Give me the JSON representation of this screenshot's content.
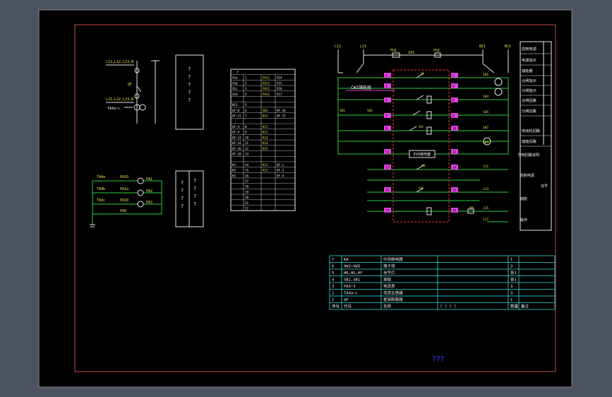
{
  "colors": {
    "app_bg": "#4b5361",
    "sheet_bg": "#000000",
    "sheet_border": "#8a8a8a",
    "frame_border": "#c0504d",
    "wire_white": "#e8e8e8",
    "wire_green": "#2ecc40",
    "wire_magenta": "#e040e0",
    "wire_red": "#ff3030",
    "text_yellow": "#f5e642",
    "text_white": "#f0f0f0",
    "table_cyan": "#38e0e0",
    "stamp_blue": "#3a3aff"
  },
  "one_line": {
    "top_label": "L11,L12,L13,N",
    "mid_label": "L21,L22,L23,N",
    "breaker_label": "QF",
    "ct_label": "TA4a~c"
  },
  "terminal_box_1": {
    "lines": [
      "?",
      "?",
      "?",
      "?",
      "?"
    ]
  },
  "meter_circuit": {
    "rows": [
      {
        "ct": "TA4a",
        "ammeter": "PA1",
        "label": "PA10"
      },
      {
        "ct": "TA4b",
        "ammeter": "PA2",
        "label": "PA1a"
      },
      {
        "ct": "TA4c",
        "ammeter": "PA3",
        "label": "PA10"
      }
    ],
    "device_label": "PA0"
  },
  "terminal_box_2": {
    "col_a": [
      "?",
      "?",
      "?",
      "?"
    ],
    "col_b": [
      "?",
      "?",
      "?",
      "?"
    ]
  },
  "terminal_table": {
    "header": "?",
    "rows": [
      [
        "X1a",
        "1",
        "PA11",
        "X14"
      ],
      [
        "X1b",
        "2",
        "PA11",
        "X15"
      ],
      [
        "X1c",
        "3",
        "PA11",
        "X16"
      ],
      [
        "X1d",
        "4",
        "PA11",
        "X17"
      ],
      [
        "",
        "",
        "",
        ""
      ],
      [
        "N11",
        "5",
        "",
        ""
      ],
      [
        "QF:0",
        "6",
        "SB1",
        "QF:34"
      ],
      [
        "QF:11",
        "7",
        "N11",
        "QF:37"
      ],
      [
        "",
        "",
        "",
        ""
      ],
      [
        "QF:4",
        "8",
        "K11",
        ""
      ],
      [
        "QF:4",
        "9",
        "K12",
        ""
      ],
      [
        "QF:13",
        "10",
        "K13",
        ""
      ],
      [
        "QF:14",
        "11",
        "K14",
        ""
      ],
      [
        "QF:16",
        "12",
        "K15",
        ""
      ],
      [
        "QF:18",
        "13",
        "",
        ""
      ],
      [
        "",
        "",
        "",
        ""
      ],
      [
        "K1",
        "14",
        "K11",
        "QF:1"
      ],
      [
        "K2",
        "15",
        "K12",
        "QF:3"
      ],
      [
        "K3",
        "16",
        "",
        "QF:4"
      ],
      [
        "",
        "17",
        "",
        ""
      ],
      [
        "",
        "18",
        "",
        ""
      ],
      [
        "",
        "19",
        "",
        ""
      ],
      [
        "",
        "20",
        "",
        ""
      ],
      [
        "",
        "21",
        "",
        ""
      ],
      [
        "",
        "22",
        "",
        ""
      ]
    ]
  },
  "control_circuit": {
    "top_labels": [
      "L12",
      "L21",
      "FU1",
      "101",
      "FU2",
      "N21",
      "N11"
    ],
    "left_label": "CWI储能器",
    "node_labels": [
      "1",
      "2",
      "3",
      "4",
      "5",
      "6",
      "7",
      "8",
      "9",
      "10",
      "11",
      "12",
      "13",
      "14",
      "15",
      "16",
      "17",
      "18",
      "19",
      "20",
      "21",
      "22",
      "23",
      "24"
    ],
    "relay_label": "中间继电器",
    "side_labels": [
      "QF",
      "SB1",
      "SB2",
      "KA",
      "HR",
      "HG",
      "KM"
    ],
    "right_numbers": [
      "101",
      "103",
      "105",
      "107",
      "109",
      "111",
      "113",
      "115",
      "117"
    ]
  },
  "function_column": {
    "items": [
      "控制电源",
      "电源指示",
      "储能器",
      "合闸指示",
      "分闸指示",
      "合闸回路",
      "分闸回路",
      "电动机回路",
      "储能回路",
      "控制回路",
      "故障信号",
      "联锁",
      "远方/就地",
      "操作"
    ],
    "header": "控制回路说明",
    "sub1": "控制电源",
    "sub2": "信号",
    "sub3": "储能",
    "sub4": "操作"
  },
  "parts_table": {
    "rows": [
      {
        "no": "7",
        "code": "KA",
        "name": "中间继电器",
        "spec": "",
        "qty": "1",
        "note": ""
      },
      {
        "no": "6",
        "code": "XW1~XW3",
        "name": "端子排",
        "spec": "",
        "qty": "3",
        "note": ""
      },
      {
        "no": "5",
        "code": "HR,HG,HY",
        "name": "信号灯",
        "spec": "",
        "qty": "各1",
        "note": ""
      },
      {
        "no": "4",
        "code": "SB2,SB1",
        "name": "按钮",
        "spec": "",
        "qty": "各1",
        "note": ""
      },
      {
        "no": "3",
        "code": "PA1~3",
        "name": "电流表",
        "spec": "",
        "qty": "3",
        "note": ""
      },
      {
        "no": "2",
        "code": "TA4a~c",
        "name": "电流互感器",
        "spec": "",
        "qty": "3",
        "note": ""
      },
      {
        "no": "1",
        "code": "QF",
        "name": "框架断路器",
        "spec": "",
        "qty": "1",
        "note": ""
      }
    ],
    "header": {
      "no": "序号",
      "code": "代号",
      "name": "名称",
      "spec": "? ? ? ?",
      "qty": "数量",
      "note": "备注"
    }
  },
  "stamp": "???"
}
